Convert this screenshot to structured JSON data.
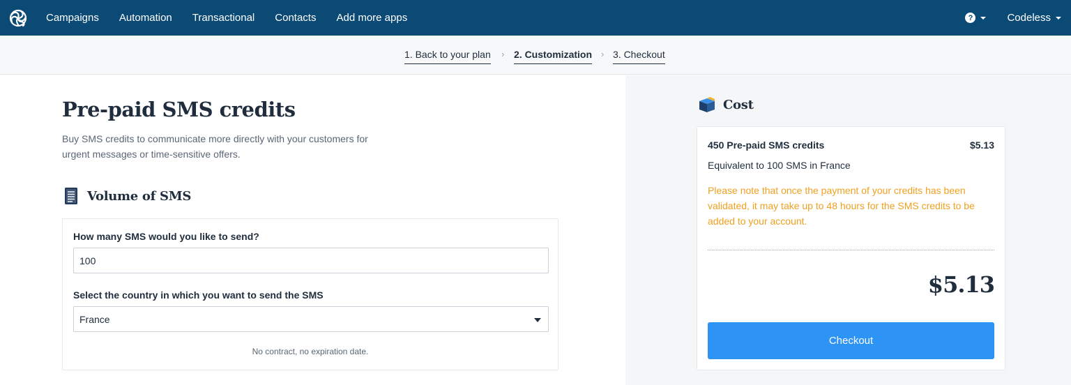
{
  "nav": {
    "items": [
      "Campaigns",
      "Automation",
      "Transactional",
      "Contacts",
      "Add more apps"
    ],
    "help_icon": "question-circle-icon",
    "account_label": "Codeless"
  },
  "steps": {
    "items": [
      "1. Back to your plan",
      "2. Customization",
      "3. Checkout"
    ],
    "active_index": 1
  },
  "page": {
    "title": "Pre-paid SMS credits",
    "description": "Buy SMS credits to communicate more directly with your customers for urgent messages or time-sensitive offers."
  },
  "volume": {
    "title": "Volume of SMS",
    "quantity_label": "How many SMS would you like to send?",
    "quantity_value": "100",
    "country_label": "Select the country in which you want to send the SMS",
    "country_value": "France",
    "note": "No contract, no expiration date."
  },
  "cost": {
    "title": "Cost",
    "item_label": "450 Pre-paid SMS credits",
    "item_price": "$5.13",
    "equivalent": "Equivalent to 100 SMS in France",
    "warning": "Please note that once the payment of your credits has been validated, it may take up to 48 hours for the SMS credits to be added to your account.",
    "total": "$5.13",
    "checkout_label": "Checkout"
  },
  "colors": {
    "nav_bg": "#0b4a75",
    "accent": "#2d93f5",
    "warning": "#f0a020"
  }
}
